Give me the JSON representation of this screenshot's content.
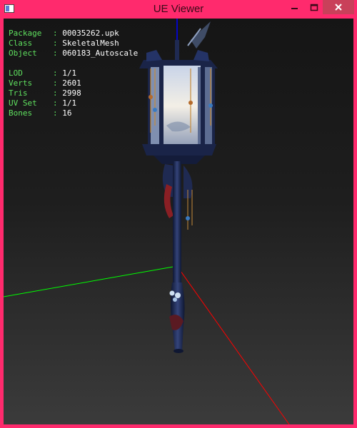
{
  "window": {
    "title": "UE Viewer",
    "accent_color": "#ff2a6d",
    "controls": [
      "minimize-icon",
      "maximize-icon",
      "close-icon"
    ]
  },
  "info_panel": {
    "label_color": "#5fe05f",
    "value_color": "#ffffff",
    "object_info": [
      {
        "label": "Package",
        "value": "00035262.upk"
      },
      {
        "label": "Class  ",
        "value": "SkeletalMesh"
      },
      {
        "label": "Object ",
        "value": "060183_Autoscale"
      }
    ],
    "mesh_stats": [
      {
        "label": "LOD    ",
        "value": "1/1"
      },
      {
        "label": "Verts  ",
        "value": "2601"
      },
      {
        "label": "Tris   ",
        "value": "2998"
      },
      {
        "label": "UV Set ",
        "value": "1/1"
      },
      {
        "label": "Bones  ",
        "value": "16"
      }
    ]
  },
  "axes": {
    "x_axis_color": "#ff0000",
    "y_axis_color": "#00ff00",
    "z_axis_color": "#0000ff"
  }
}
